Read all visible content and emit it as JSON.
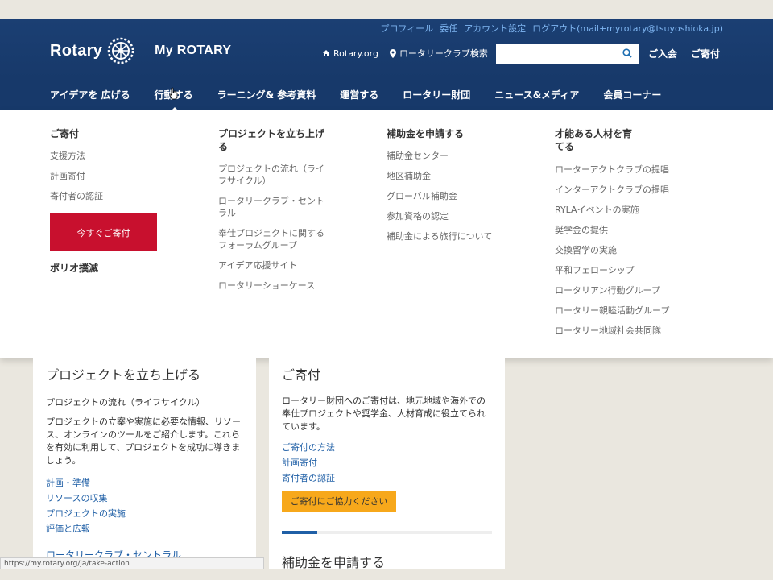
{
  "utility": {
    "links": [
      "プロフィール",
      "委任",
      "アカウント設定",
      "ログアウト(mail+myrotary@tsuyoshioka.jp)"
    ]
  },
  "logo": {
    "rotary": "Rotary",
    "myrotary": "My ROTARY"
  },
  "header": {
    "rotary_org": "Rotary.org",
    "club_search": "ロータリークラブ検索",
    "search_placeholder": "",
    "join": "ご入会",
    "donate": "ご寄付"
  },
  "nav": {
    "items": [
      "アイデアを 広げる",
      "行動する",
      "ラーニング& 参考資料",
      "運営する",
      "ロータリー財団",
      "ニュース&メディア",
      "会員コーナー"
    ]
  },
  "dropdown": {
    "col1": {
      "title": "ご寄付",
      "links": [
        "支援方法",
        "計画寄付",
        "寄付者の認証"
      ],
      "button": "今すぐご寄付",
      "polio": "ポリオ撲滅"
    },
    "col2": {
      "title": "プロジェクトを立ち上げる",
      "links": [
        "プロジェクトの流れ（ライフサイクル）",
        "ロータリークラブ・セントラル",
        "奉仕プロジェクトに関するフォーラムグループ",
        "アイデア応援サイト",
        "ロータリーショーケース"
      ]
    },
    "col3": {
      "title": "補助金を申請する",
      "links": [
        "補助金センター",
        "地区補助金",
        "グローバル補助金",
        "参加資格の認定",
        "補助金による旅行について"
      ]
    },
    "col4": {
      "title": "才能ある人材を育てる",
      "links": [
        "ローターアクトクラブの提唱",
        "インターアクトクラブの提唱",
        "RYLAイベントの実施",
        "奨学金の提供",
        "交換留学の実施",
        "平和フェローシップ",
        "ロータリアン行動グループ",
        "ロータリー親睦活動グループ",
        "ロータリー地域社会共同隊"
      ]
    }
  },
  "card1": {
    "title": "プロジェクトを立ち上げる",
    "subtitle": "プロジェクトの流れ（ライフサイクル）",
    "desc": "プロジェクトの立案や実施に必要な情報、リソース、オンラインのツールをご紹介します。これらを有効に利用して、プロジェクトを成功に導きましょう。",
    "links": [
      "計画・準備",
      "リソースの収集",
      "プロジェクトの実施",
      "評価と広報"
    ],
    "bottom_link": "ロータリークラブ・セントラル"
  },
  "card2": {
    "title": "ご寄付",
    "desc": "ロータリー財団へのご寄付は、地元地域や海外での奉仕プロジェクトや奨学金、人材育成に役立てられています。",
    "links": [
      "ご寄付の方法",
      "計画寄付",
      "寄付者の認証"
    ],
    "button": "ご寄付にご協力ください",
    "next_title": "補助金を申請する"
  },
  "status": {
    "url": "https://my.rotary.org/ja/take-action"
  },
  "colors": {
    "header": "#17396a",
    "accent_red": "#c8102e",
    "accent_yellow": "#f7a81b",
    "link": "#1f5fa6"
  }
}
